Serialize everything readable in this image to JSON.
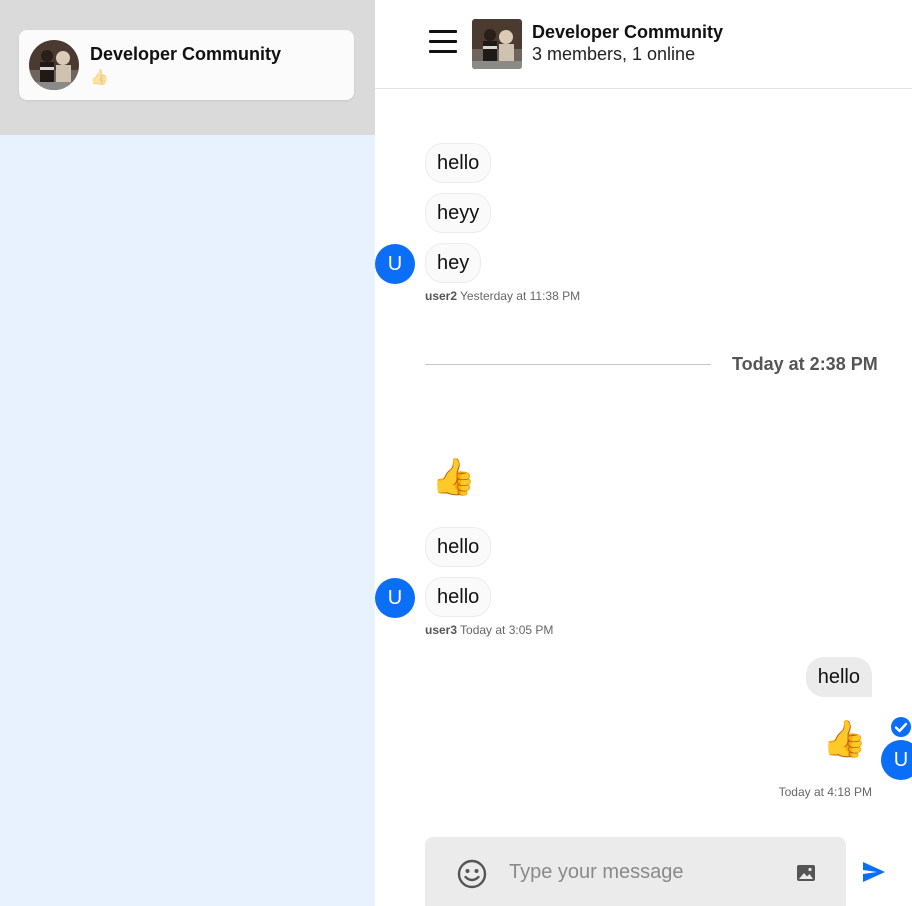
{
  "colors": {
    "accent": "#0b6ef6",
    "sidebar_bg": "#e8f2fe",
    "sidebar_top_bg": "#dadada",
    "my_bubble": "#ebebeb"
  },
  "sidebar": {
    "chats": [
      {
        "title": "Developer Community",
        "preview": "👍",
        "avatar_icon": "group-photo-icon"
      }
    ]
  },
  "header": {
    "title": "Developer Community",
    "subtitle": "3 members, 1 online",
    "menu_icon": "hamburger-menu-icon",
    "avatar_icon": "group-photo-icon"
  },
  "messages": {
    "group1": {
      "bubbles": [
        "hello",
        "heyy",
        "hey"
      ],
      "avatar": "U",
      "sender": "user2",
      "time": "Yesterday at 11:38 PM"
    },
    "divider": "Today at 2:38 PM",
    "group2": {
      "emoji": "👍",
      "bubbles": [
        "hello",
        "hello"
      ],
      "avatar": "U",
      "sender": "user3",
      "time": "Today at 3:05 PM"
    },
    "mine": {
      "bubble": "hello",
      "emoji": "👍",
      "avatar": "U",
      "time": "Today at 4:18 PM",
      "status_icon": "read-check-icon"
    }
  },
  "composer": {
    "placeholder": "Type your message",
    "value": "",
    "emoji_icon": "smiley-icon",
    "image_icon": "image-icon",
    "send_icon": "send-icon"
  }
}
